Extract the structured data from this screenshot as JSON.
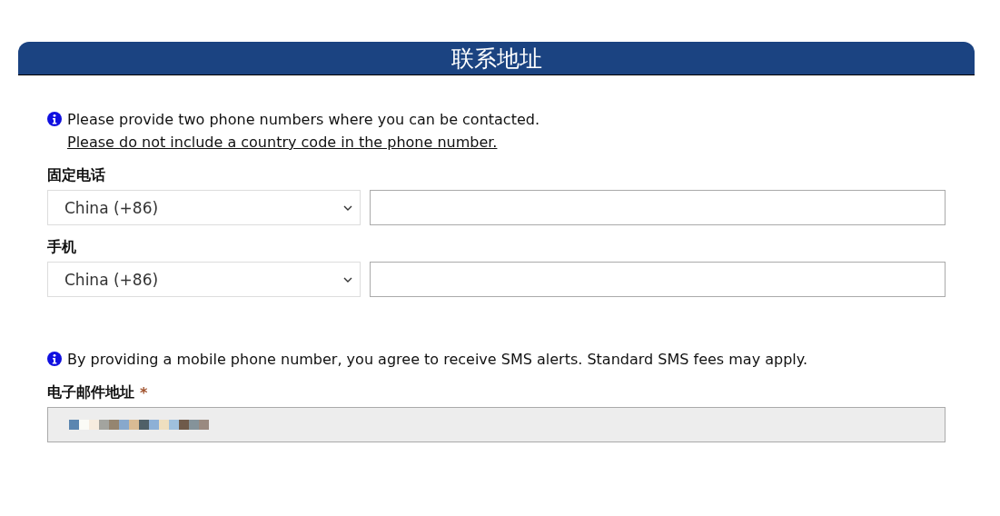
{
  "section": {
    "title": "联系地址"
  },
  "notices": [
    {
      "text": "Please provide two phone numbers where you can be contacted.",
      "link": "Please do not include a country code in the phone number."
    }
  ],
  "phones": [
    {
      "label": "固定电话",
      "country": "China (+86)"
    },
    {
      "label": "手机",
      "country": "China (+86)"
    }
  ],
  "sms_notice": {
    "text": "By providing a mobile phone number, you agree to receive SMS alerts. Standard SMS fees may apply."
  },
  "email": {
    "label": "电子邮件地址",
    "required_mark": "*",
    "disabled": true,
    "redacted": true
  }
}
